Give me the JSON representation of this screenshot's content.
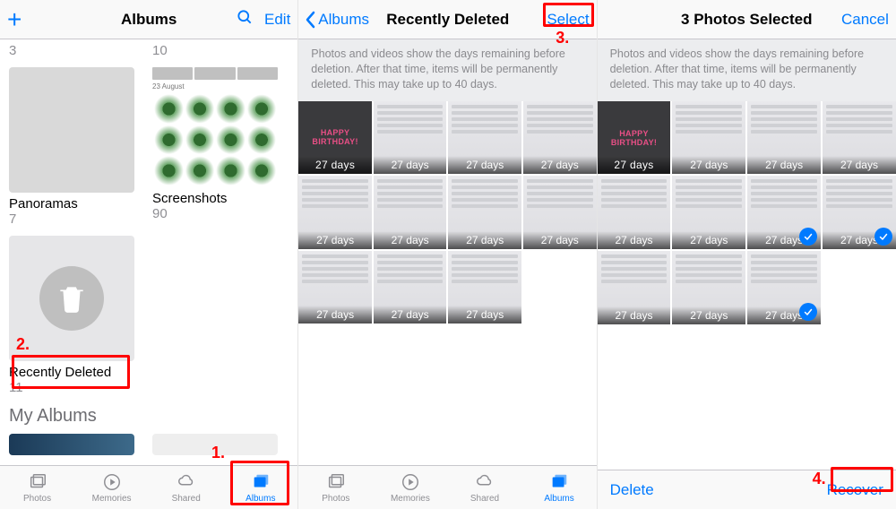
{
  "accent": "#007aff",
  "pane1": {
    "title": "Albums",
    "edit": "Edit",
    "albums": [
      {
        "name": "",
        "count": "3"
      },
      {
        "name": "",
        "count": "10"
      },
      {
        "name": "Panoramas",
        "count": "7"
      },
      {
        "name": "Screenshots",
        "count": "90",
        "sub": "23 August"
      },
      {
        "name": "Recently Deleted",
        "count": "11"
      }
    ],
    "section": "My Albums",
    "tabs": [
      "Photos",
      "Memories",
      "Shared",
      "Albums"
    ]
  },
  "pane2": {
    "back": "Albums",
    "title": "Recently Deleted",
    "select": "Select",
    "banner": "Photos and videos show the days remaining before deletion. After that time, items will be permanently deleted. This may take up to 40 days.",
    "days": [
      "27 days",
      "27 days",
      "27 days",
      "27 days",
      "27 days",
      "27 days",
      "27 days",
      "27 days",
      "27 days",
      "27 days",
      "27 days"
    ],
    "tabs": [
      "Photos",
      "Memories",
      "Shared",
      "Albums"
    ]
  },
  "pane3": {
    "title": "3 Photos Selected",
    "cancel": "Cancel",
    "banner": "Photos and videos show the days remaining before deletion. After that time, items will be permanently deleted. This may take up to 40 days.",
    "days": [
      "27 days",
      "27 days",
      "27 days",
      "27 days",
      "27 days",
      "27 days",
      "27 days",
      "27 days",
      "27 days",
      "27 days",
      "27 days"
    ],
    "selected_indices": [
      6,
      7,
      10
    ],
    "delete": "Delete",
    "recover": "Recover"
  },
  "callouts": {
    "c1": "1.",
    "c2": "2.",
    "c3": "3.",
    "c4": "4."
  }
}
